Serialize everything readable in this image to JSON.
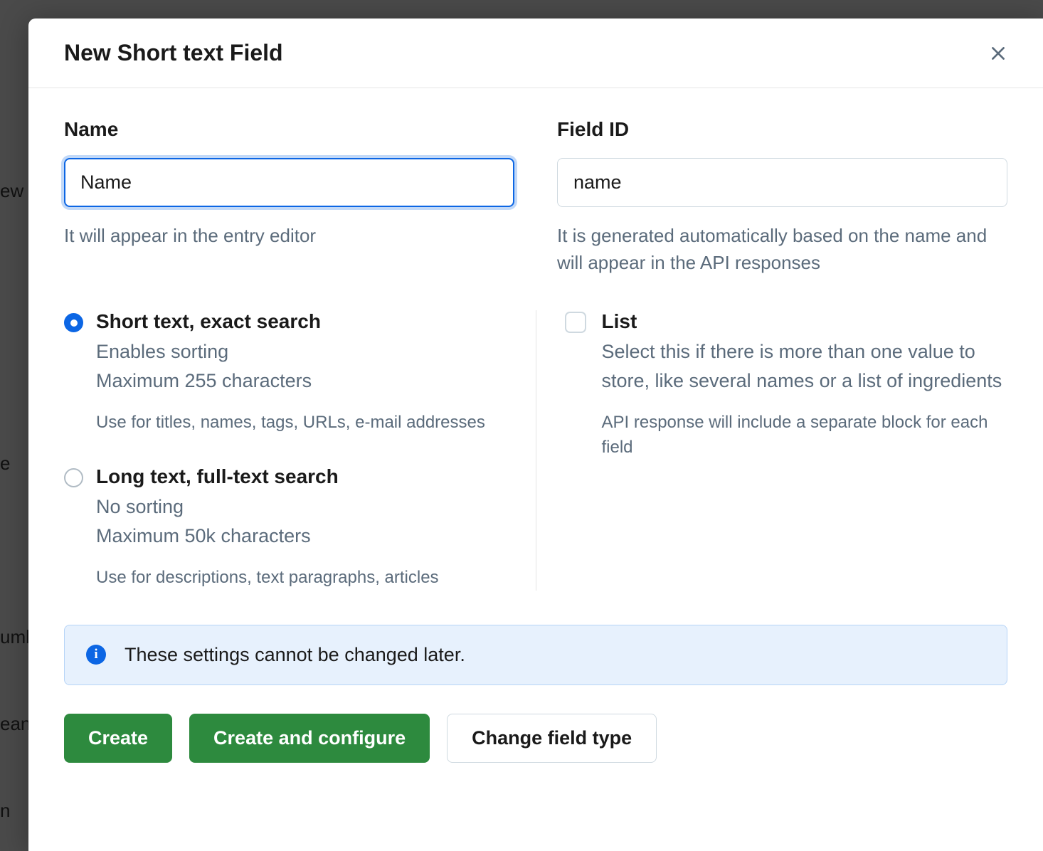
{
  "backdrop": {
    "items": [
      "ew",
      "e",
      "umb",
      "ean",
      "n"
    ]
  },
  "modal": {
    "title": "New Short text Field",
    "name": {
      "label": "Name",
      "value": "Name",
      "help": "It will appear in the entry editor"
    },
    "fieldId": {
      "label": "Field ID",
      "value": "name",
      "help": "It is generated automatically based on the name and will appear in the API responses"
    },
    "options": {
      "shortText": {
        "title": "Short text, exact search",
        "line1": "Enables sorting",
        "line2": "Maximum 255 characters",
        "hint": "Use for titles, names, tags, URLs, e-mail addresses"
      },
      "longText": {
        "title": "Long text, full-text search",
        "line1": "No sorting",
        "line2": "Maximum 50k characters",
        "hint": "Use for descriptions, text paragraphs, articles"
      },
      "list": {
        "title": "List",
        "description": "Select this if there is more than one value to store, like several names or a list of ingredients",
        "hint": "API response will include a separate block for each field"
      }
    },
    "infoBanner": "These settings cannot be changed later.",
    "buttons": {
      "create": "Create",
      "createConfigure": "Create and configure",
      "changeType": "Change field type"
    }
  }
}
